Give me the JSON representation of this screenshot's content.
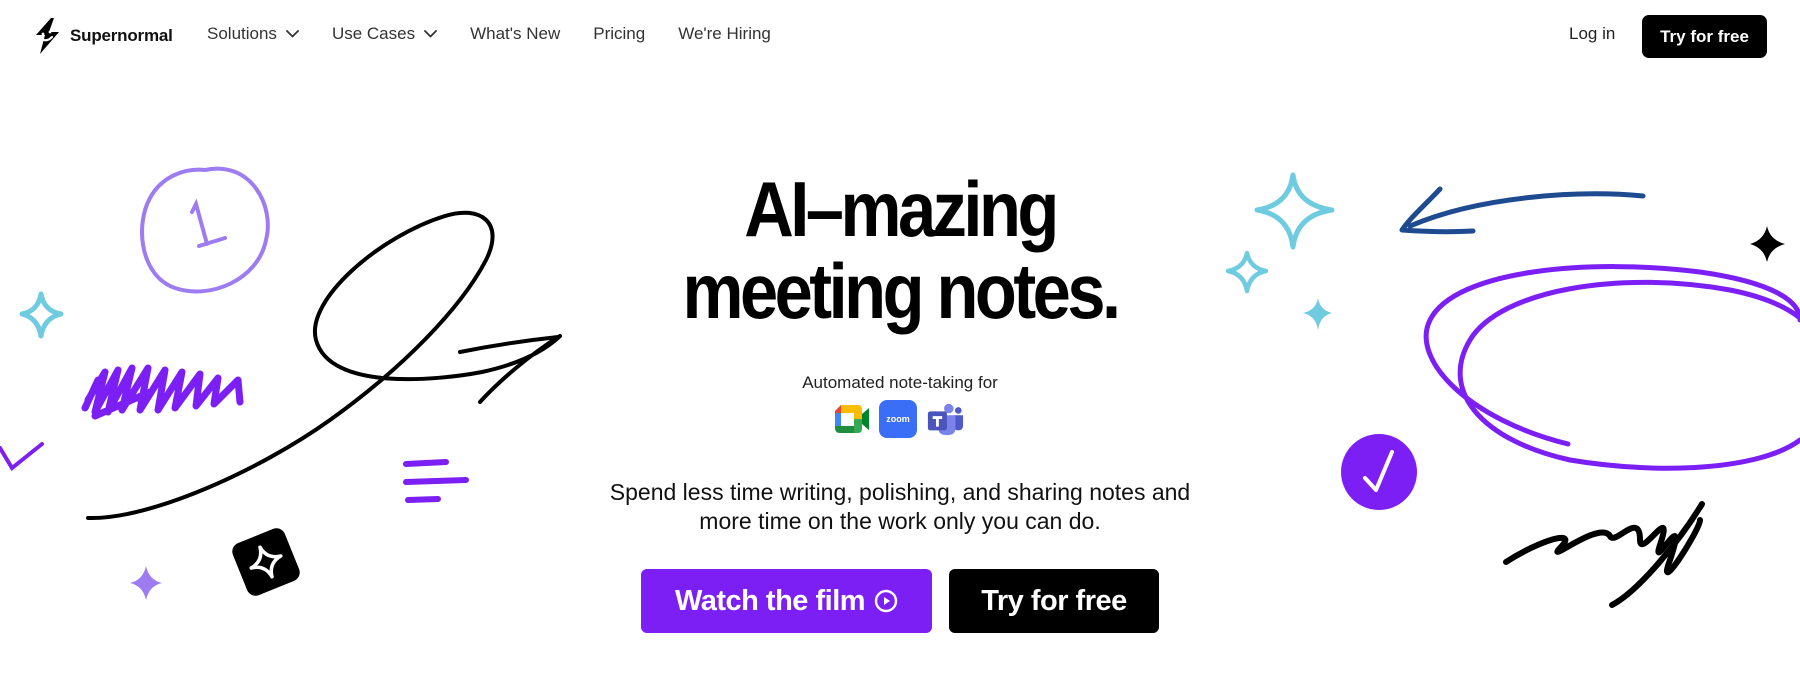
{
  "brand": {
    "name": "Supernormal"
  },
  "nav": {
    "links": [
      {
        "label": "Solutions",
        "has_dropdown": true
      },
      {
        "label": "Use Cases",
        "has_dropdown": true
      },
      {
        "label": "What's New",
        "has_dropdown": false
      },
      {
        "label": "Pricing",
        "has_dropdown": false
      },
      {
        "label": "We're Hiring",
        "has_dropdown": false
      }
    ],
    "login": "Log in",
    "cta": "Try for free"
  },
  "hero": {
    "headline_line1": "AI–mazing",
    "headline_line2": "meeting notes.",
    "sub_label": "Automated note-taking for",
    "integrations": [
      {
        "name": "Google Meet",
        "icon": "google-meet-icon"
      },
      {
        "name": "Zoom",
        "icon": "zoom-icon",
        "text": "zoom"
      },
      {
        "name": "Microsoft Teams",
        "icon": "teams-icon"
      }
    ],
    "tagline_line1": "Spend less time writing, polishing, and sharing notes and",
    "tagline_line2": "more time on the work only you can do.",
    "primary_button": "Watch the film",
    "secondary_button": "Try for free"
  },
  "colors": {
    "purple": "#7c1ff5",
    "lavender": "#9c7cf0",
    "cyan": "#6fcbe0",
    "navy": "#1e4a8f",
    "black": "#000000"
  }
}
